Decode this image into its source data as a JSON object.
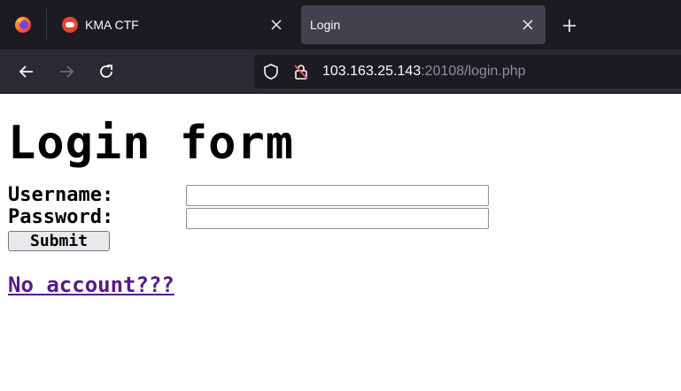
{
  "browser": {
    "tabs": [
      {
        "title": "KMA CTF",
        "active": false
      },
      {
        "title": "Login",
        "active": true
      }
    ],
    "url": {
      "host": "103.163.25.143",
      "rest": ":20108/login.php"
    },
    "icons": {
      "firefox": "firefox-logo-icon",
      "close": "close-icon",
      "new_tab": "plus-icon",
      "back": "back-arrow-icon",
      "forward": "forward-arrow-icon",
      "reload": "reload-icon",
      "tracking": "shield-icon",
      "insecure": "insecure-lock-icon"
    },
    "colors": {
      "chrome_dark": "#1c1b22",
      "toolbar": "#2b2a33",
      "active_tab": "#42414d"
    }
  },
  "page": {
    "heading": "Login form",
    "username_label": "Username:",
    "password_label": "Password:",
    "username_value": "",
    "password_value": "",
    "submit_label": "Submit",
    "link_text": "No account???",
    "colors": {
      "link_visited": "#551a8b"
    }
  }
}
